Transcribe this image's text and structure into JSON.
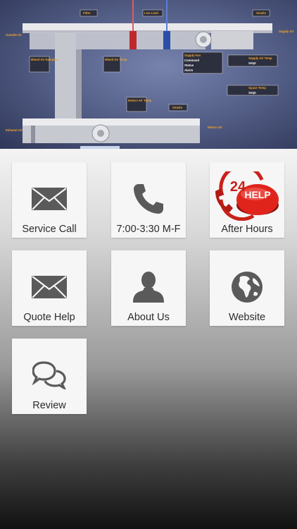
{
  "hero": {
    "labels": {
      "outside_air": "Outside Air",
      "filter": "Filter",
      "low_limit": "Low Limit",
      "smoke_top": "Smoke",
      "supply_air": "Supply Air",
      "mixed_air_dampers": "Mixed Air Dampers",
      "mixed_air_temp": "Mixed Air Temp",
      "supply_fan": "Supply Fan",
      "command": "Command",
      "status": "Status",
      "alarm": "Alarm",
      "supply_air_temp": "Supply Air Temp",
      "setpt": "Setpt",
      "space_temp": "Space Temp",
      "space_setpt": "Setpt",
      "return_air_temp": "Return Air Temp",
      "smoke_bottom": "Smoke",
      "exhaust_air": "Exhaust Air",
      "return_air": "Return Air"
    }
  },
  "tiles": [
    {
      "label": "Service Call",
      "icon": "envelope-icon"
    },
    {
      "label": "7:00-3:30 M-F",
      "icon": "phone-icon"
    },
    {
      "label": "After Hours",
      "icon": "24-help-button-icon",
      "badge_text": "24",
      "badge_text2": "HELP"
    },
    {
      "label": "Quote Help",
      "icon": "envelope-icon"
    },
    {
      "label": "About Us",
      "icon": "person-icon"
    },
    {
      "label": "Website",
      "icon": "globe-icon"
    },
    {
      "label": "Review",
      "icon": "chat-bubbles-icon"
    }
  ],
  "colors": {
    "icon_gray": "#5a5a5a",
    "label_orange": "#f4a52a",
    "help_red": "#d9261c"
  }
}
